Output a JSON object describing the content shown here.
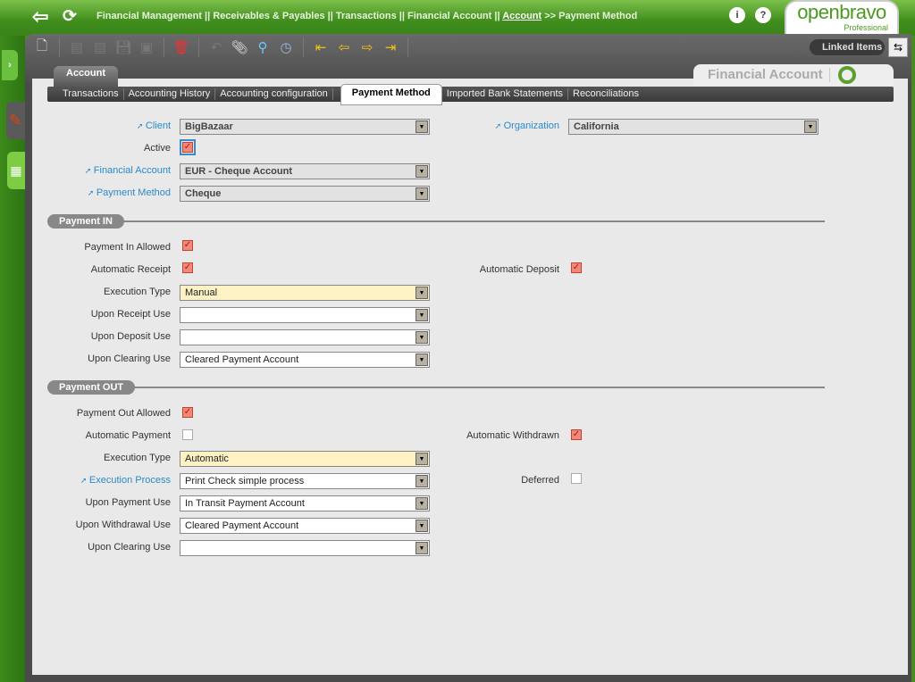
{
  "header": {
    "breadcrumb_prefix": "Financial Management || Receivables & Payables || Transactions || Financial Account  || ",
    "breadcrumb_link": "Account",
    "breadcrumb_suffix": " >> Payment Method",
    "logo": "openbravo",
    "logo_edition": "Professional"
  },
  "toolbar": {
    "linked_items": "Linked Items"
  },
  "window": {
    "parent_tab": "Account",
    "title": "Financial Account"
  },
  "tabs": [
    "Transactions",
    "Accounting History",
    "Accounting configuration",
    "Payment Method",
    "Imported Bank Statements",
    "Reconciliations"
  ],
  "form": {
    "client": {
      "label": "Client",
      "value": "BigBazaar"
    },
    "organization": {
      "label": "Organization",
      "value": "California"
    },
    "active": {
      "label": "Active",
      "checked": true
    },
    "financial_account": {
      "label": "Financial Account",
      "value": "EUR - Cheque Account"
    },
    "payment_method": {
      "label": "Payment Method",
      "value": "Cheque"
    }
  },
  "payment_in": {
    "title": "Payment IN",
    "allowed": {
      "label": "Payment In Allowed",
      "checked": true
    },
    "auto_receipt": {
      "label": "Automatic Receipt",
      "checked": true
    },
    "auto_deposit": {
      "label": "Automatic Deposit",
      "checked": true
    },
    "execution_type": {
      "label": "Execution Type",
      "value": "Manual"
    },
    "upon_receipt": {
      "label": "Upon Receipt Use",
      "value": ""
    },
    "upon_deposit": {
      "label": "Upon Deposit Use",
      "value": ""
    },
    "upon_clearing": {
      "label": "Upon Clearing Use",
      "value": "Cleared Payment Account"
    }
  },
  "payment_out": {
    "title": "Payment OUT",
    "allowed": {
      "label": "Payment Out Allowed",
      "checked": true
    },
    "auto_payment": {
      "label": "Automatic Payment",
      "checked": false
    },
    "auto_withdrawn": {
      "label": "Automatic Withdrawn",
      "checked": true
    },
    "execution_type": {
      "label": "Execution Type",
      "value": "Automatic"
    },
    "execution_process": {
      "label": "Execution Process",
      "value": "Print Check simple process"
    },
    "deferred": {
      "label": "Deferred",
      "checked": false
    },
    "upon_payment": {
      "label": "Upon Payment Use",
      "value": "In Transit Payment Account"
    },
    "upon_withdrawal": {
      "label": "Upon Withdrawal Use",
      "value": "Cleared Payment Account"
    },
    "upon_clearing": {
      "label": "Upon Clearing Use",
      "value": ""
    }
  }
}
